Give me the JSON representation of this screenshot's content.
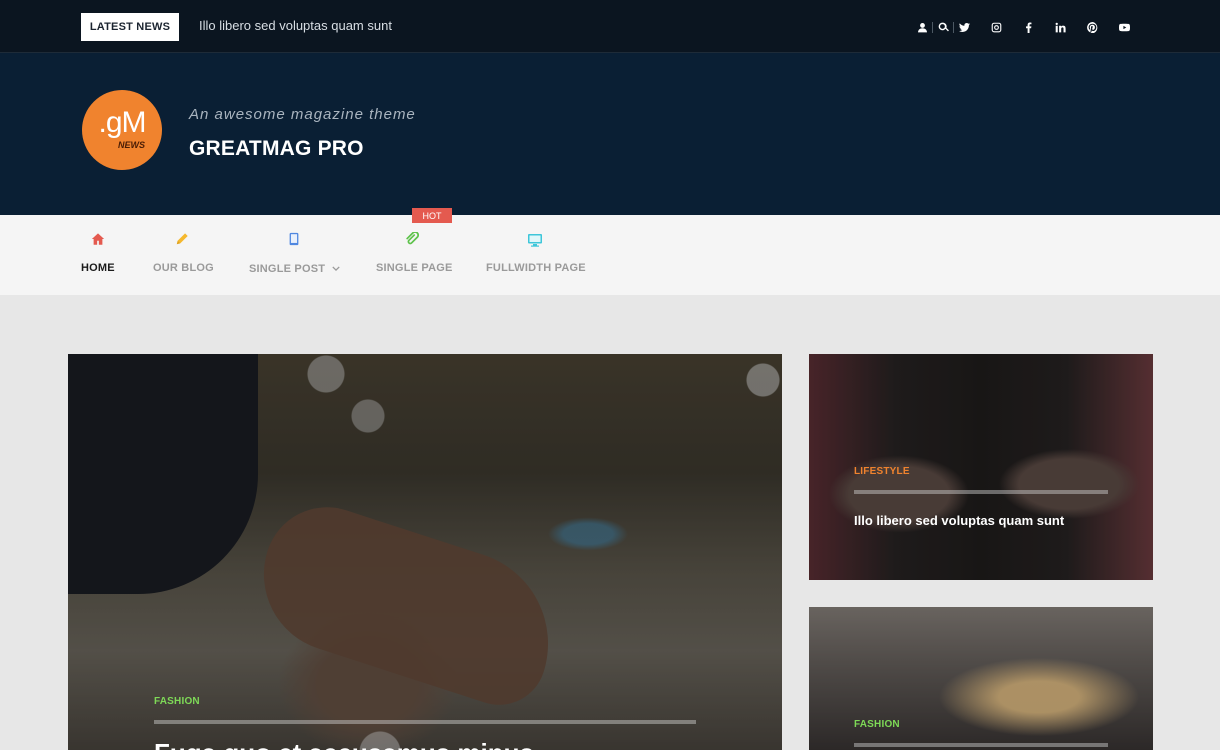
{
  "topbar": {
    "latest_label": "LATEST NEWS",
    "ticker_text": "Illo libero sed voluptas quam sunt",
    "icons": [
      "user-icon",
      "search-icon",
      "twitter-icon",
      "instagram-icon",
      "facebook-icon",
      "linkedin-icon",
      "pinterest-icon",
      "youtube-icon"
    ]
  },
  "header": {
    "logo_text": ".gM",
    "logo_sub": "NEWS",
    "tagline": "An awesome magazine theme",
    "site_title": "GREATMAG PRO"
  },
  "nav": {
    "items": [
      {
        "label": "HOME",
        "icon": "home-icon",
        "color": "#e45a4f",
        "active": true
      },
      {
        "label": "OUR BLOG",
        "icon": "pencil-icon",
        "color": "#f5b82e"
      },
      {
        "label": "SINGLE POST",
        "icon": "tablet-icon",
        "color": "#4f87e0",
        "has_dropdown": true
      },
      {
        "label": "SINGLE PAGE",
        "icon": "paperclip-icon",
        "color": "#5dc24a",
        "badge": "HOT"
      },
      {
        "label": "FULLWIDTH PAGE",
        "icon": "monitor-icon",
        "color": "#3ec6d9"
      }
    ]
  },
  "posts": [
    {
      "category": "FASHION",
      "category_color": "#7ed957",
      "title": "Fuga quo et accusamus minus"
    },
    {
      "category": "LIFESTYLE",
      "category_color": "#f0832e",
      "title": "Illo libero sed voluptas quam sunt"
    },
    {
      "category": "FASHION",
      "category_color": "#7ed957",
      "title": ""
    }
  ]
}
